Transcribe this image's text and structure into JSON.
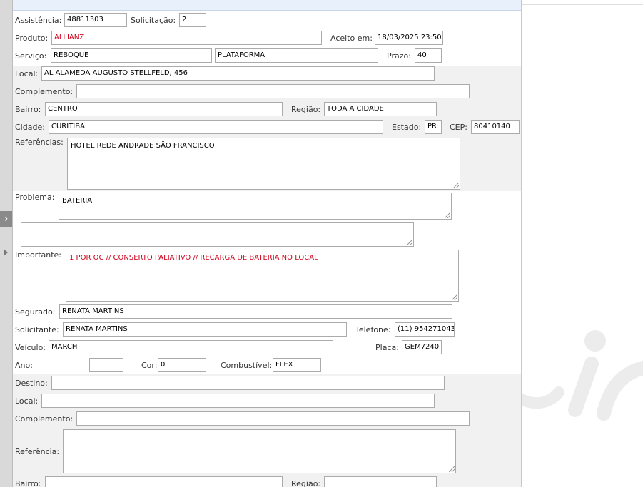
{
  "form": {
    "assistencia": {
      "label": "Assistência:",
      "value": "48811303"
    },
    "solicitacao": {
      "label": "Solicitação:",
      "value": "2"
    },
    "produto": {
      "label": "Produto:",
      "value": "ALLIANZ"
    },
    "aceito": {
      "label": "Aceito em:",
      "value": "18/03/2025 23:50"
    },
    "servico": {
      "label": "Serviço:",
      "value": "REBOQUE",
      "value2": "PLATAFORMA"
    },
    "prazo": {
      "label": "Prazo:",
      "value": "40"
    },
    "local": {
      "label": "Local:",
      "value": "AL ALAMEDA AUGUSTO STELLFELD, 456"
    },
    "complemento": {
      "label": "Complemento:",
      "value": ""
    },
    "bairro": {
      "label": "Bairro:",
      "value": "CENTRO"
    },
    "regiao": {
      "label": "Região:",
      "value": "TODA A CIDADE"
    },
    "cidade": {
      "label": "Cidade:",
      "value": "CURITIBA"
    },
    "estado": {
      "label": "Estado:",
      "value": "PR"
    },
    "cep": {
      "label": "CEP:",
      "value": "80410140"
    },
    "referencias": {
      "label": "Referências:",
      "value": "HOTEL REDE ANDRADE SÃO FRANCISCO"
    },
    "problema": {
      "label": "Problema:",
      "value": "BATERIA"
    },
    "extra": {
      "value": ""
    },
    "importante": {
      "label": "Importante:",
      "value": "1 POR OC // CONSERTO PALIATIVO // RECARGA DE BATERIA NO LOCAL"
    },
    "segurado": {
      "label": "Segurado:",
      "value": "RENATA MARTINS"
    },
    "solicitante": {
      "label": "Solicitante:",
      "value": "RENATA MARTINS"
    },
    "telefone": {
      "label": "Telefone:",
      "value": "(11) 954271043"
    },
    "veiculo": {
      "label": "Veículo:",
      "value": "MARCH"
    },
    "placa": {
      "label": "Placa:",
      "value": "GEM7240"
    },
    "ano": {
      "label": "Ano:",
      "value": ""
    },
    "cor": {
      "label": "Cor:",
      "value": "0"
    },
    "combustivel": {
      "label": "Combustível:",
      "value": "FLEX"
    },
    "destino": {
      "label": "Destino:",
      "value": ""
    },
    "dest_local": {
      "label": "Local:",
      "value": ""
    },
    "dest_complemento": {
      "label": "Complemento:",
      "value": ""
    },
    "dest_referencia": {
      "label": "Referência:",
      "value": ""
    },
    "dest_bairro": {
      "label": "Bairro:",
      "value": ""
    },
    "dest_regiao": {
      "label": "Região:",
      "value": ""
    }
  },
  "colors": {
    "accent_red": "#d0021b",
    "header_blue": "#e8f1fb",
    "band_gray": "#f1f1f1"
  },
  "icons": {
    "collapse": "chevron-right-icon",
    "expand": "triangle-right-icon"
  }
}
